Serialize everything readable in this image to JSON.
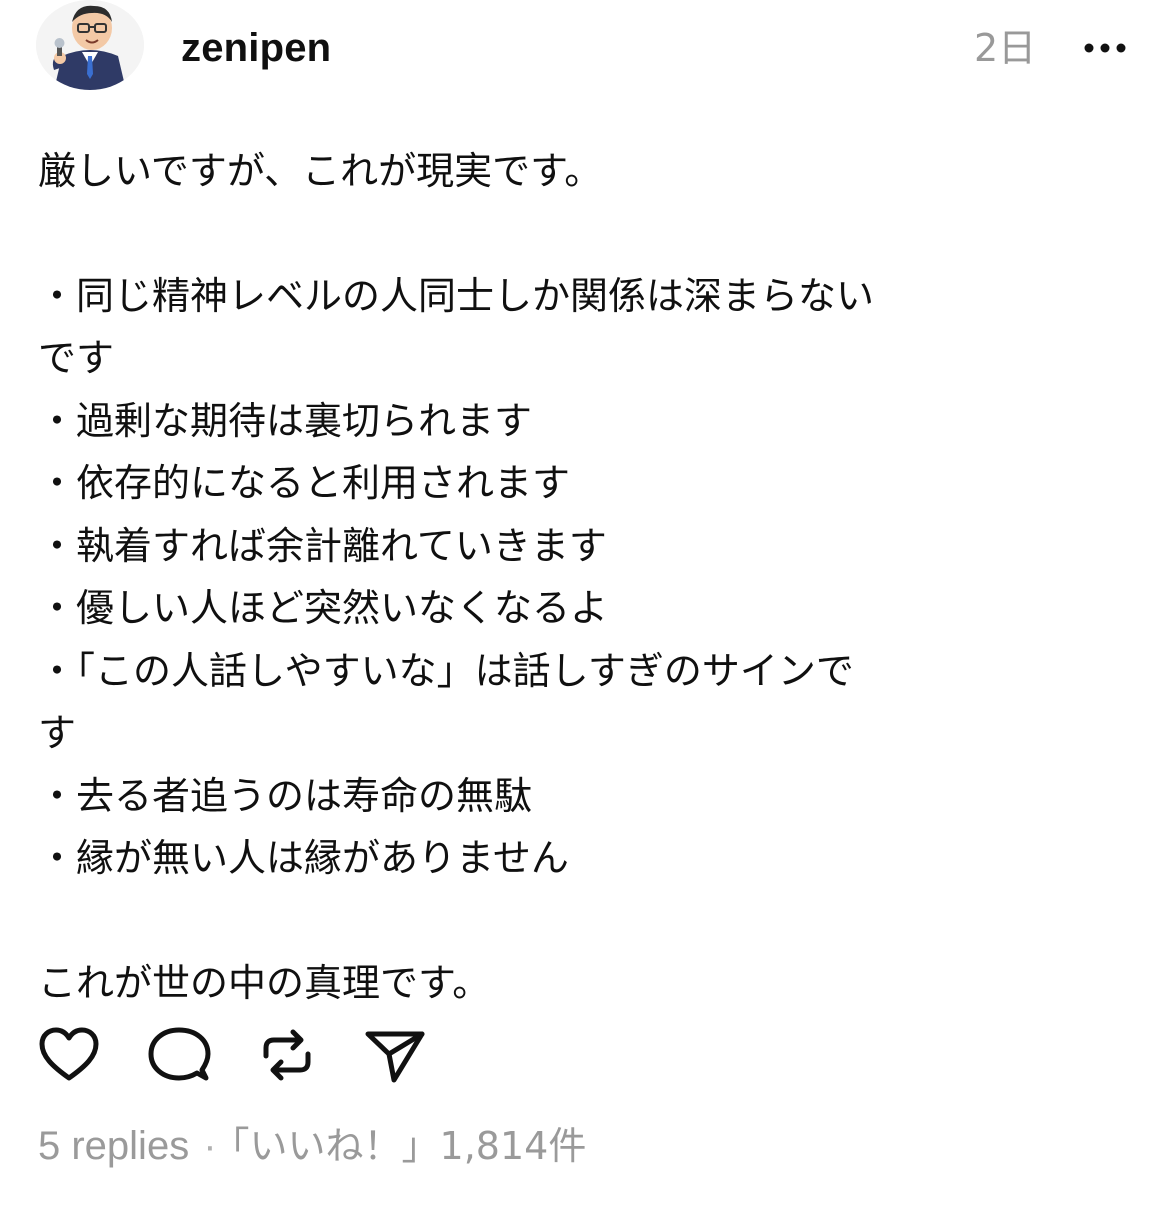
{
  "post": {
    "author": {
      "username": "zenipen",
      "avatar_icon": "businessman-avatar"
    },
    "timestamp": "2日",
    "more_icon": "more-dots-icon",
    "body": {
      "intro": "厳しいですが、これが現実です。",
      "lines": [
        "・同じ精神レベルの人同士しか関係は深まらない",
        "です",
        "・過剰な期待は裏切られます",
        "・依存的になると利用されます",
        "・執着すれば余計離れていきます",
        "・優しい人ほど突然いなくなるよ",
        "・「この人話しやすいな」は話しすぎのサインで",
        "す",
        "・去る者追うのは寿命の無駄",
        "・縁が無い人は縁がありません"
      ],
      "outro": "これが世の中の真理です。"
    },
    "actions": {
      "like_icon": "heart-icon",
      "reply_icon": "comment-bubble-icon",
      "repost_icon": "repost-icon",
      "share_icon": "send-icon"
    },
    "stats": {
      "replies": "5 replies",
      "separator": "·",
      "likes": "「いいね！」1,814件"
    }
  }
}
